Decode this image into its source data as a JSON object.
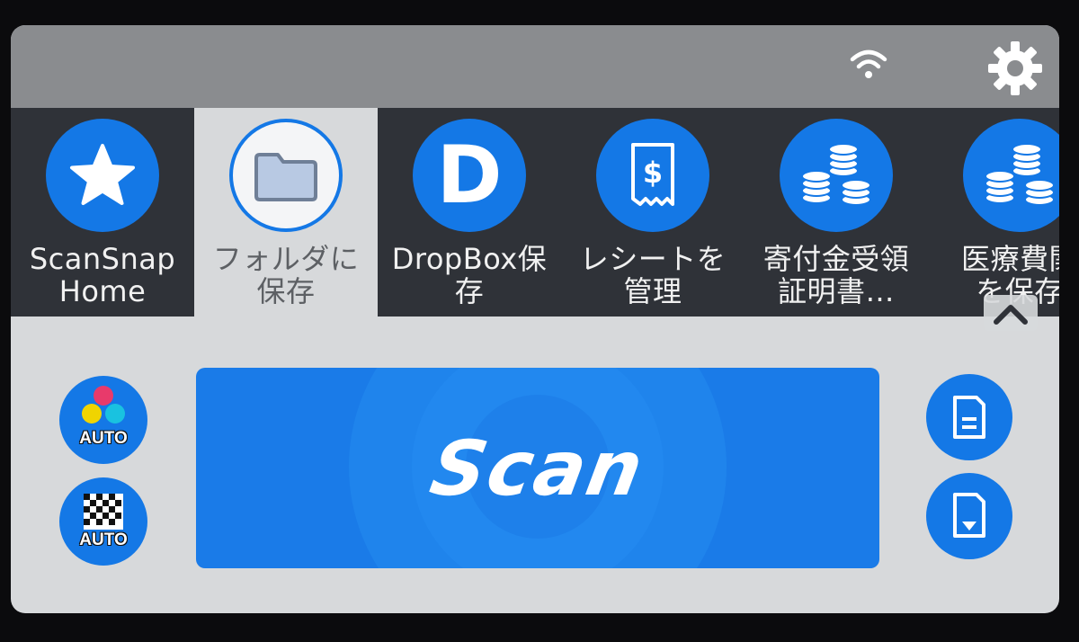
{
  "status_bar": {
    "wifi_icon": "wifi-icon",
    "settings_icon": "gear-icon"
  },
  "profiles": [
    {
      "label": "ScanSnap\nHome",
      "icon": "star-icon",
      "active": false
    },
    {
      "label": "フォルダに\n保存",
      "icon": "folder-icon",
      "active": true
    },
    {
      "label": "DropBox保\n存",
      "icon": "dropbox-d-icon",
      "active": false
    },
    {
      "label": "レシートを\n管理",
      "icon": "receipt-icon",
      "active": false
    },
    {
      "label": "寄付金受領\n証明書…",
      "icon": "coins-icon",
      "active": false
    },
    {
      "label": "医療費関\nを保存",
      "icon": "coins-icon",
      "active": false
    }
  ],
  "controls": {
    "color_mode_label": "AUTO",
    "resolution_label": "AUTO",
    "scan_label": "Scan",
    "collapse_icon": "chevron-up-icon",
    "paper_size_icon": "document-icon",
    "feed_option_icon": "document-download-icon"
  },
  "colors": {
    "accent": "#1478e6",
    "tab_bar": "#2f3238",
    "status_bar": "#8a8c8f",
    "panel": "#d7d9db"
  }
}
